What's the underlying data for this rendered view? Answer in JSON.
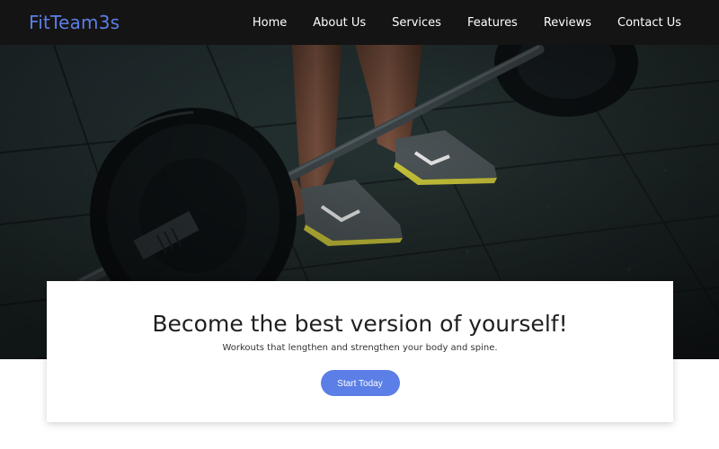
{
  "brand": {
    "name": "FitTeam3s"
  },
  "nav": {
    "items": [
      {
        "label": "Home"
      },
      {
        "label": "About Us"
      },
      {
        "label": "Services"
      },
      {
        "label": "Features"
      },
      {
        "label": "Reviews"
      },
      {
        "label": "Contact Us"
      }
    ]
  },
  "hero": {
    "headline": "Become the best version of yourself!",
    "subtext": "Workouts that lengthen and strengthen your body and spine.",
    "cta_label": "Start Today"
  },
  "colors": {
    "accent": "#5b7fe6",
    "navbar_bg": "#151414"
  }
}
